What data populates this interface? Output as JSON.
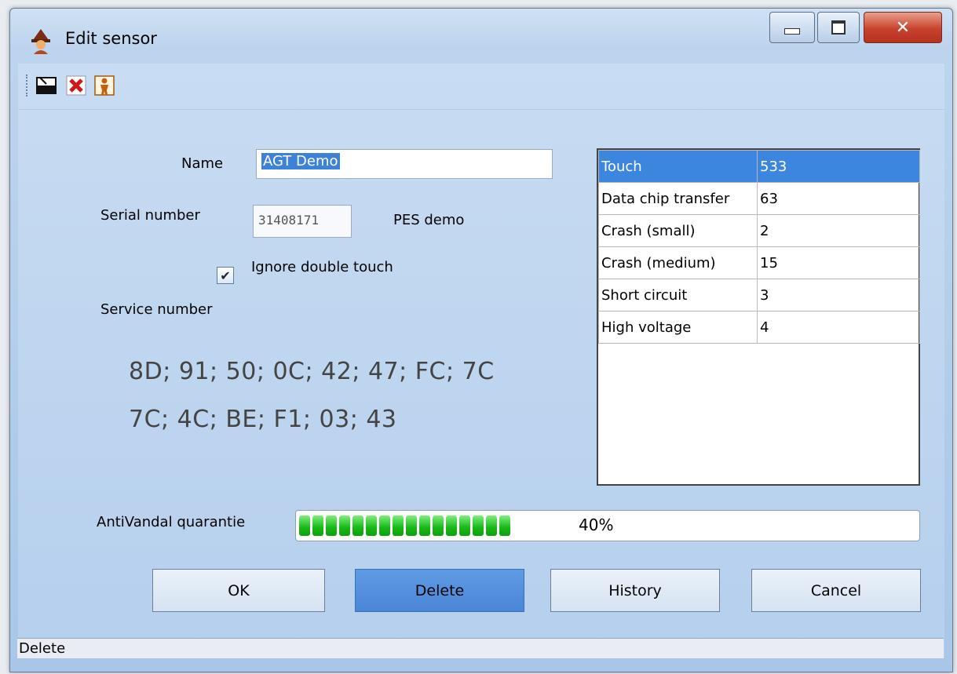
{
  "window": {
    "title": "Edit sensor"
  },
  "toolbar": {
    "icons": [
      "card-reader-icon",
      "delete-x-icon",
      "person-icon"
    ]
  },
  "form": {
    "name_label": "Name",
    "name_value": "AGT Demo",
    "serial_label": "Serial number",
    "serial_value": "31408171",
    "serial_type": "PES demo",
    "ignore_double_touch_label": "Ignore double touch",
    "ignore_double_touch_checked": true,
    "service_label": "Service number",
    "service_line1": "8D; 91; 50; 0C; 42; 47; FC; 7C",
    "service_line2": "7C; 4C; BE; F1; 03; 43"
  },
  "stats": {
    "rows": [
      {
        "name": "Touch",
        "value": "533",
        "selected": true
      },
      {
        "name": "Data chip transfer",
        "value": "63"
      },
      {
        "name": "Crash (small)",
        "value": "2"
      },
      {
        "name": "Crash (medium)",
        "value": "15"
      },
      {
        "name": "Short circuit",
        "value": "3"
      },
      {
        "name": "High voltage",
        "value": "4"
      }
    ]
  },
  "progress": {
    "label": "AntiVandal quarantie",
    "percent": 40,
    "text": "40%",
    "color": "#16b816"
  },
  "buttons": {
    "ok": "OK",
    "delete": "Delete",
    "history": "History",
    "cancel": "Cancel"
  },
  "status": {
    "text": "Delete"
  },
  "colors": {
    "selection": "#3c86e0",
    "active_button": "#4a86d6"
  }
}
